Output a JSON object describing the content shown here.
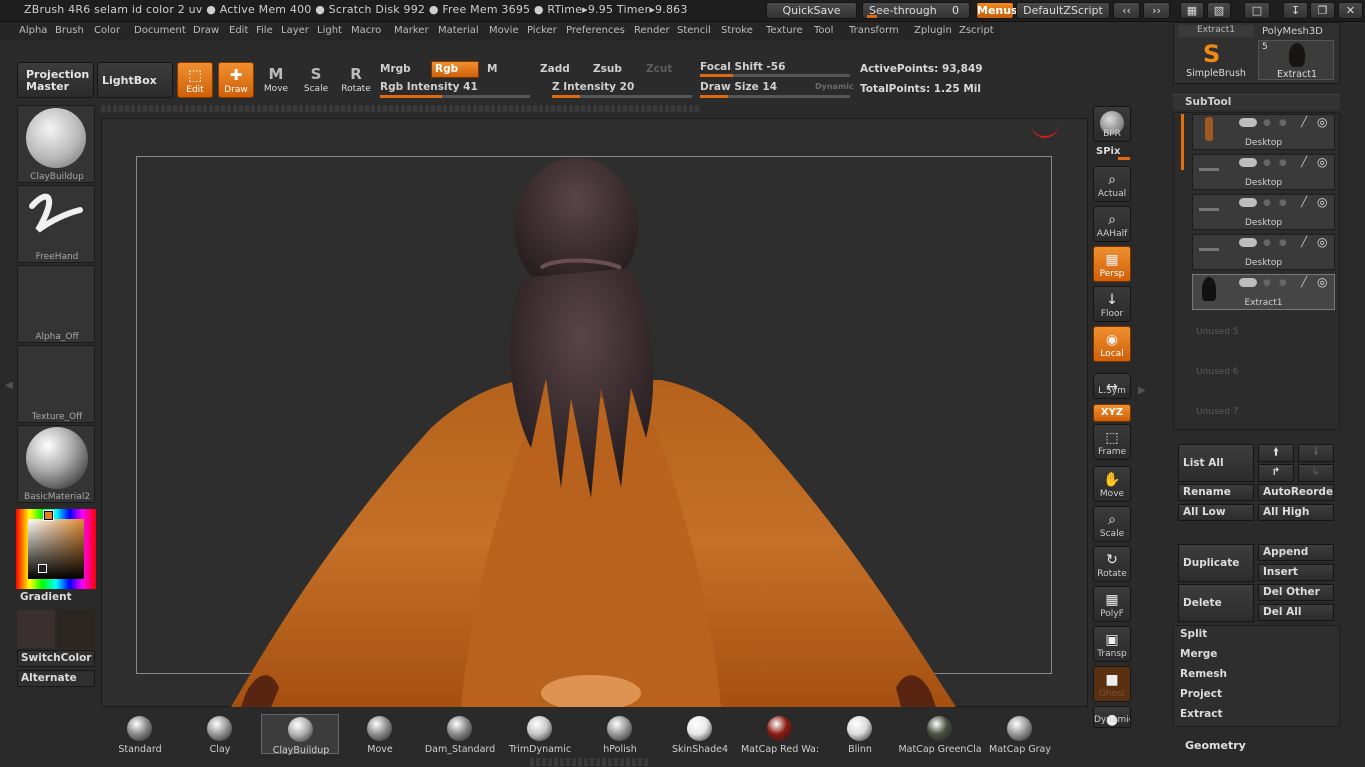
{
  "titlebar": {
    "text": "ZBrush 4R6    selam id color 2 uv    ● Active Mem 400 ● Scratch Disk 992 ● Free Mem 3695 ● RTime▸9.95 Timer▸9.863",
    "quicksave": "QuickSave",
    "see_through_label": "See-through",
    "see_through_value": "0",
    "menus": "Menus",
    "default_zscript": "DefaultZScript"
  },
  "menubar": [
    "Alpha",
    "Brush",
    "Color",
    "Document",
    "Draw",
    "Edit",
    "File",
    "Layer",
    "Light",
    "Macro",
    "Marker",
    "Material",
    "Movie",
    "Picker",
    "Preferences",
    "Render",
    "Stencil",
    "Stroke",
    "Texture",
    "Tool",
    "Transform",
    "Zplugin",
    "Zscript"
  ],
  "shelf": {
    "projection_master": "Projection Master",
    "lightbox": "LightBox",
    "tools": [
      {
        "label": "Edit",
        "icon": "edit-icon",
        "active": true
      },
      {
        "label": "Draw",
        "icon": "draw-icon",
        "active": true
      },
      {
        "label": "Move",
        "icon": "move-icon",
        "active": false
      },
      {
        "label": "Scale",
        "icon": "scale-icon",
        "active": false
      },
      {
        "label": "Rotate",
        "icon": "rotate-icon",
        "active": false
      }
    ],
    "mrgb": "Mrgb",
    "rgb": "Rgb",
    "m": "M",
    "zadd": "Zadd",
    "zsub": "Zsub",
    "zcut": "Zcut",
    "rgb_intensity": "Rgb Intensity 41",
    "rgb_intensity_value": 41,
    "z_intensity": "Z Intensity 20",
    "z_intensity_value": 20,
    "focal_shift": "Focal Shift -56",
    "focal_shift_value": -56,
    "draw_size": "Draw Size 14",
    "draw_size_value": 14,
    "dynamic": "Dynamic",
    "active_points": "ActivePoints: 93,849",
    "total_points": "TotalPoints: 1.25 Mil"
  },
  "left_tray": {
    "brush": "ClayBuildup",
    "stroke": "FreeHand",
    "alpha": "Alpha_Off",
    "texture": "Texture_Off",
    "material": "BasicMaterial2",
    "gradient": "Gradient",
    "switchcolor": "SwitchColor",
    "alternate": "Alternate",
    "colors": {
      "main": "#3a3030",
      "secondary": "#2b2622"
    }
  },
  "right_toolbar": [
    {
      "label": "BPR",
      "icon": "bpr-sphere-icon",
      "on": false
    },
    {
      "label": "SPix",
      "icon": "spix-slider-icon",
      "on": false
    },
    {
      "label": "Actual",
      "icon": "actual-zoom-icon",
      "on": false
    },
    {
      "label": "AAHalf",
      "icon": "aahalf-zoom-icon",
      "on": false
    },
    {
      "label": "Persp",
      "icon": "persp-grid-icon",
      "on": true
    },
    {
      "label": "Floor",
      "icon": "floor-icon",
      "on": false
    },
    {
      "label": "Local",
      "icon": "local-icon",
      "on": true
    },
    {
      "label": "L.Sym",
      "icon": "lsym-icon",
      "on": false
    },
    {
      "label": "XYZ",
      "icon": "xyz-icon",
      "on": true
    },
    {
      "label": "Frame",
      "icon": "frame-icon",
      "on": false
    },
    {
      "label": "Move",
      "icon": "move-hand-icon",
      "on": false
    },
    {
      "label": "Scale",
      "icon": "scale-zoom-icon",
      "on": false
    },
    {
      "label": "Rotate",
      "icon": "rotate-icon",
      "on": false
    },
    {
      "label": "PolyF",
      "icon": "polyf-grid-icon",
      "on": false
    },
    {
      "label": "Transp",
      "icon": "transp-icon",
      "on": false
    },
    {
      "label": "Ghost",
      "icon": "ghost-icon",
      "on": false
    },
    {
      "label": "Dynamic",
      "icon": "dynamic-icon",
      "on": false
    }
  ],
  "right_panel": {
    "top_tools": {
      "tool1": "Extract1",
      "tool2": "PolyMesh3D",
      "tool3": "SimpleBrush",
      "tool4": "Extract1",
      "tool4_count": "5"
    },
    "subtool_title": "SubTool",
    "subtools": [
      "Desktop",
      "Desktop",
      "Desktop",
      "Desktop",
      "Extract1"
    ],
    "unused": [
      "Unused 5",
      "Unused 6",
      "Unused 7"
    ],
    "list_all": "List All",
    "rename": "Rename",
    "autoreorder": "AutoReorder",
    "all_low": "All Low",
    "all_high": "All High",
    "duplicate": "Duplicate",
    "append": "Append",
    "insert": "Insert",
    "delete": "Delete",
    "del_other": "Del Other",
    "del_all": "Del All",
    "split": "Split",
    "merge": "Merge",
    "remesh": "Remesh",
    "project": "Project",
    "extract": "Extract",
    "geometry": "Geometry"
  },
  "materials": [
    {
      "label": "Standard",
      "color": "#8a8a8a"
    },
    {
      "label": "Clay",
      "color": "#9a9a9a"
    },
    {
      "label": "ClayBuildup",
      "color": "#b0b0b0"
    },
    {
      "label": "Move",
      "color": "#8f8f8f"
    },
    {
      "label": "Dam_Standard",
      "color": "#8a8a8a"
    },
    {
      "label": "TrimDynamic",
      "color": "#c8c8c8"
    },
    {
      "label": "hPolish",
      "color": "#9a9a9a"
    },
    {
      "label": "SkinShade4",
      "color": "#e8e8e8"
    },
    {
      "label": "MatCap Red Wa:",
      "color": "#8a1a10"
    },
    {
      "label": "Blinn",
      "color": "#dcdcdc"
    },
    {
      "label": "MatCap GreenCla",
      "color": "#4a5040"
    },
    {
      "label": "MatCap Gray",
      "color": "#9a9a9a"
    }
  ]
}
